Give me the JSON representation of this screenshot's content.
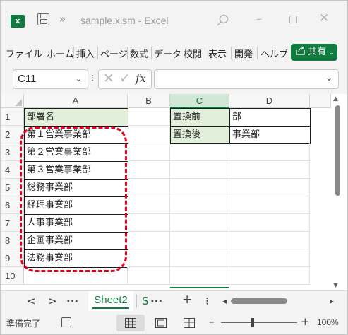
{
  "titlebar": {
    "app_icon_letter": "x",
    "more": "»",
    "title": "sample.xlsm - Excel",
    "minimize": "–",
    "close": "✕"
  },
  "ribbon": {
    "tabs": [
      "ファイル",
      "ホーム",
      "挿入",
      "ページ",
      "数式",
      "データ",
      "校閲",
      "表示",
      "開発",
      "ヘルプ"
    ],
    "share_label": "共有"
  },
  "formula_bar": {
    "name_box": "C11",
    "dots": "⁝",
    "cancel": "✕",
    "enter": "✓",
    "fx": "fx",
    "formula": ""
  },
  "grid": {
    "columns": [
      "A",
      "B",
      "C",
      "D"
    ],
    "selected_column": "C",
    "rows": [
      "1",
      "2",
      "3",
      "4",
      "5",
      "6",
      "7",
      "8",
      "9",
      "10"
    ],
    "column_a": [
      "部署名",
      "第１営業事業部",
      "第２営業事業部",
      "第３営業事業部",
      "総務事業部",
      "経理事業部",
      "人事事業部",
      "企画事業部",
      "法務事業部",
      ""
    ],
    "lookup_table": {
      "c1": "置換前",
      "d1": "部",
      "c2": "置換後",
      "d2": "事業部"
    },
    "highlight_color": "#e8001c"
  },
  "sheet_tabs": {
    "prev": "<",
    "next": ">",
    "more": "···",
    "active": "Sheet2",
    "partial_next": "S",
    "more_right": "···",
    "add": "+",
    "options": "⁝",
    "hscroll_left": "◂",
    "hscroll_right": "▸"
  },
  "status": {
    "ready": "準備完了",
    "zoom_minus": "–",
    "zoom_plus": "+",
    "zoom": "100%"
  },
  "colors": {
    "excel_green": "#107c41",
    "header_fill": "#e2efda"
  }
}
